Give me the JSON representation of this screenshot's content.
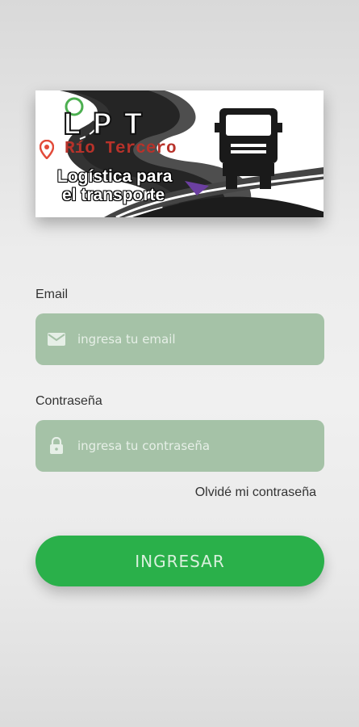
{
  "logo": {
    "brand": "LPT",
    "city": "Río Tercero",
    "tagline_line1": "Logística para",
    "tagline_line2": "el transporte"
  },
  "form": {
    "email": {
      "label": "Email",
      "placeholder": "ingresa tu email",
      "value": ""
    },
    "password": {
      "label": "Contraseña",
      "placeholder": "ingresa tu contraseña",
      "value": ""
    },
    "forgot_link": "Olvidé mi contraseña",
    "submit_label": "INGRESAR"
  },
  "colors": {
    "field_bg": "#a5c2a7",
    "button_bg": "#2ab04a",
    "pin_red": "#e24b3a",
    "city_text": "#b8322a"
  }
}
